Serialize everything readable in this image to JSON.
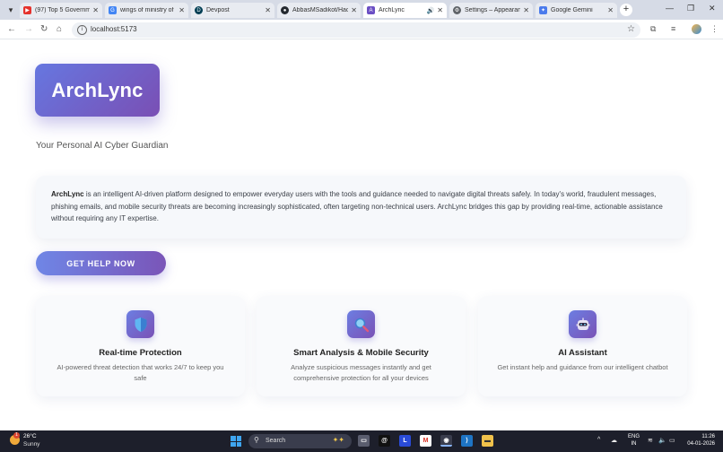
{
  "browser": {
    "tabs": [
      {
        "title": "(97) Top 5 Governm",
        "favicon": "youtube-icon",
        "favicon_color": "#e5322d",
        "active": false
      },
      {
        "title": "wings of ministry of",
        "favicon": "google-icon",
        "favicon_color": "#4285f4",
        "active": false
      },
      {
        "title": "Devpost",
        "favicon": "devpost-icon",
        "favicon_color": "#003e54",
        "active": false
      },
      {
        "title": "AbbasMSadikot/Hac",
        "favicon": "github-icon",
        "favicon_color": "#24292f",
        "active": false
      },
      {
        "title": "ArchLync",
        "favicon": "archlync-icon",
        "favicon_color": "#6b4fc4",
        "active": true
      },
      {
        "title": "Settings – Appearan",
        "favicon": "gear-icon",
        "favicon_color": "#5f6368",
        "active": false
      },
      {
        "title": "Google Gemini",
        "favicon": "gemini-icon",
        "favicon_color": "#4b7bec",
        "active": false
      }
    ],
    "address": "localhost:5173"
  },
  "page": {
    "logo": "ArchLync",
    "tagline": "Your Personal AI Cyber Guardian",
    "intro": {
      "brand": "ArchLync",
      "text": " is an intelligent AI-driven platform designed to empower everyday users with the tools and guidance needed to navigate digital threats safely. In today's world, fraudulent messages, phishing emails, and mobile security threats are becoming increasingly sophisticated, often targeting non-technical users. ArchLync bridges this gap by providing real-time, actionable assistance without requiring any IT expertise."
    },
    "cta_label": "GET HELP NOW",
    "features": [
      {
        "icon": "shield-icon",
        "title": "Real-time Protection",
        "desc": "AI-powered threat detection that works 24/7 to keep you safe"
      },
      {
        "icon": "magnifier-icon",
        "title": "Smart Analysis & Mobile Security",
        "desc": "Analyze suspicious messages instantly and get comprehensive protection for all your devices"
      },
      {
        "icon": "robot-icon",
        "title": "AI Assistant",
        "desc": "Get instant help and guidance from our intelligent chatbot"
      }
    ],
    "colors": {
      "accent_start": "#6677e0",
      "accent_end": "#7a4fb4"
    }
  },
  "taskbar": {
    "weather": {
      "temp": "26°C",
      "desc": "Sunny",
      "badge": "1"
    },
    "search_label": "Search",
    "lang_top": "ENG",
    "lang_bottom": "IN",
    "time": "11:26",
    "date": "04-01-2026"
  }
}
